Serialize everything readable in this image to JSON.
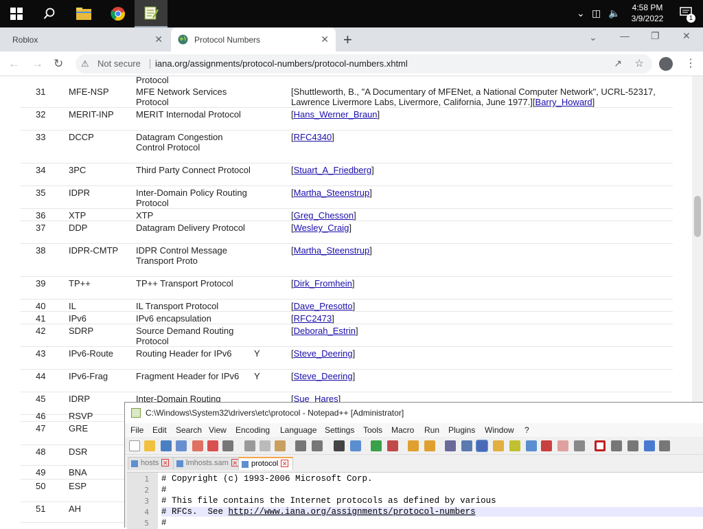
{
  "taskbar": {
    "time": "4:58 PM",
    "date": "3/9/2022",
    "notification_count": "1",
    "icons": [
      "windows-icon",
      "search-icon",
      "file-explorer-icon",
      "chrome-icon",
      "notepadpp-icon"
    ]
  },
  "browser": {
    "tabs": [
      {
        "label": "Roblox"
      },
      {
        "label": "Protocol Numbers"
      }
    ],
    "security_label": "Not secure",
    "url": "iana.org/assignments/protocol-numbers/protocol-numbers.xhtml"
  },
  "table": {
    "top_fragment": "Protocol",
    "rows": [
      {
        "num": "31",
        "kw": "MFE-NSP",
        "desc": "MFE Network Services Protocol",
        "ipv6": "",
        "ref_text": "[Shuttleworth, B., \"A Documentary of MFENet, a National Computer Network\", UCRL-52317, Lawrence Livermore Labs, Livermore, California, June 1977.]",
        "ref_link": "Barry_Howard"
      },
      {
        "num": "32",
        "kw": "MERIT-INP",
        "desc": "MERIT Internodal Protocol",
        "ipv6": "",
        "ref_text": "",
        "ref_link": "Hans_Werner_Braun"
      },
      {
        "num": "33",
        "kw": "DCCP",
        "desc": "Datagram Congestion Control Protocol",
        "ipv6": "",
        "ref_text": "",
        "ref_link": "RFC4340"
      },
      {
        "num": "34",
        "kw": "3PC",
        "desc": "Third Party Connect Protocol",
        "ipv6": "",
        "ref_text": "",
        "ref_link": "Stuart_A_Friedberg"
      },
      {
        "num": "35",
        "kw": "IDPR",
        "desc": "Inter-Domain Policy Routing Protocol",
        "ipv6": "",
        "ref_text": "",
        "ref_link": "Martha_Steenstrup"
      },
      {
        "num": "36",
        "kw": "XTP",
        "desc": "XTP",
        "ipv6": "",
        "ref_text": "",
        "ref_link": "Greg_Chesson"
      },
      {
        "num": "37",
        "kw": "DDP",
        "desc": "Datagram Delivery Protocol",
        "ipv6": "",
        "ref_text": "",
        "ref_link": "Wesley_Craig"
      },
      {
        "num": "38",
        "kw": "IDPR-CMTP",
        "desc": "IDPR Control Message Transport Proto",
        "ipv6": "",
        "ref_text": "",
        "ref_link": "Martha_Steenstrup"
      },
      {
        "num": "39",
        "kw": "TP++",
        "desc": "TP++ Transport Protocol",
        "ipv6": "",
        "ref_text": "",
        "ref_link": "Dirk_Fromhein"
      },
      {
        "num": "40",
        "kw": "IL",
        "desc": "IL Transport Protocol",
        "ipv6": "",
        "ref_text": "",
        "ref_link": "Dave_Presotto"
      },
      {
        "num": "41",
        "kw": "IPv6",
        "desc": "IPv6 encapsulation",
        "ipv6": "",
        "ref_text": "",
        "ref_link": "RFC2473"
      },
      {
        "num": "42",
        "kw": "SDRP",
        "desc": "Source Demand Routing Protocol",
        "ipv6": "",
        "ref_text": "",
        "ref_link": "Deborah_Estrin"
      },
      {
        "num": "43",
        "kw": "IPv6-Route",
        "desc": "Routing Header for IPv6",
        "ipv6": "Y",
        "ref_text": "",
        "ref_link": "Steve_Deering"
      },
      {
        "num": "44",
        "kw": "IPv6-Frag",
        "desc": "Fragment Header for IPv6",
        "ipv6": "Y",
        "ref_text": "",
        "ref_link": "Steve_Deering"
      },
      {
        "num": "45",
        "kw": "IDRP",
        "desc": "Inter-Domain Routing",
        "ipv6": "",
        "ref_text": "",
        "ref_link": "Sue_Hares"
      },
      {
        "num": "46",
        "kw": "RSVP",
        "desc": "",
        "ipv6": "",
        "ref_text": "",
        "ref_link": ""
      },
      {
        "num": "47",
        "kw": "GRE",
        "desc": "",
        "ipv6": "",
        "ref_text": "",
        "ref_link": ""
      },
      {
        "num": "48",
        "kw": "DSR",
        "desc": "",
        "ipv6": "",
        "ref_text": "",
        "ref_link": ""
      },
      {
        "num": "49",
        "kw": "BNA",
        "desc": "",
        "ipv6": "",
        "ref_text": "",
        "ref_link": ""
      },
      {
        "num": "50",
        "kw": "ESP",
        "desc": "",
        "ipv6": "",
        "ref_text": "",
        "ref_link": ""
      },
      {
        "num": "51",
        "kw": "AH",
        "desc": "",
        "ipv6": "",
        "ref_text": "",
        "ref_link": ""
      }
    ]
  },
  "notepad": {
    "title": "C:\\Windows\\System32\\drivers\\etc\\protocol - Notepad++ [Administrator]",
    "menu": [
      "File",
      "Edit",
      "Search",
      "View",
      "Encoding",
      "Language",
      "Settings",
      "Tools",
      "Macro",
      "Run",
      "Plugins",
      "Window",
      "?"
    ],
    "tabs": [
      "hosts",
      "lmhosts.sam",
      "protocol"
    ],
    "lines": [
      {
        "n": "1",
        "text": "# Copyright (c) 1993-2006 Microsoft Corp."
      },
      {
        "n": "2",
        "text": "#"
      },
      {
        "n": "3",
        "text": "# This file contains the Internet protocols as defined by various"
      },
      {
        "n": "4",
        "text": "# RFCs.  See ",
        "link": "http://www.iana.org/assignments/protocol-numbers"
      },
      {
        "n": "5",
        "text": "#"
      }
    ]
  }
}
